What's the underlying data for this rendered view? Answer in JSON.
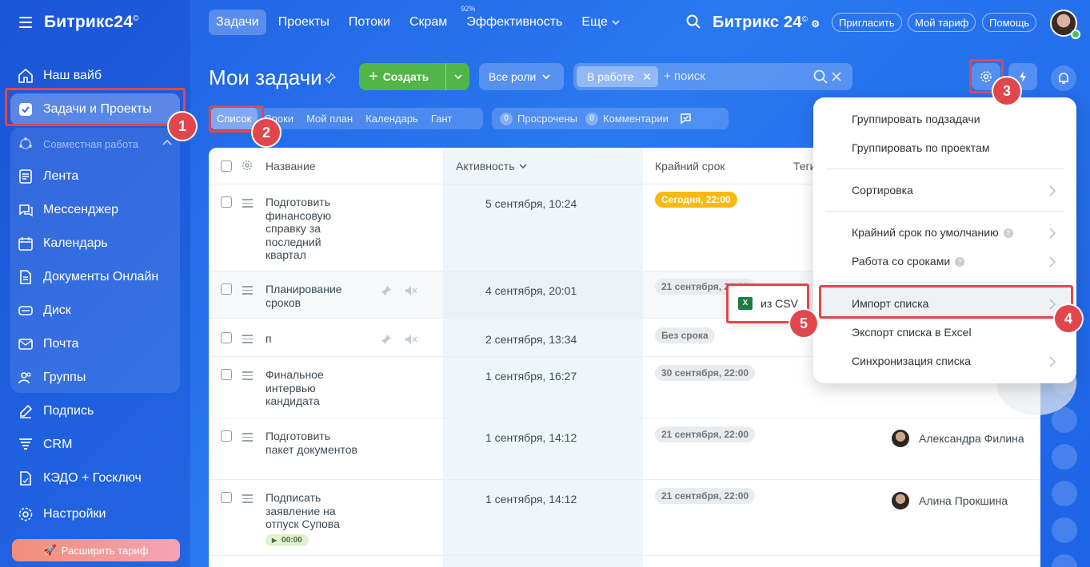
{
  "sidebar": {
    "logo": "Битрикс24",
    "logo_mark": "©",
    "items": [
      {
        "label": "Наш вайб"
      },
      {
        "label": "Задачи и Проекты"
      },
      {
        "label": "Совместная работа"
      },
      {
        "label": "Лента"
      },
      {
        "label": "Мессенджер"
      },
      {
        "label": "Календарь"
      },
      {
        "label": "Документы Онлайн"
      },
      {
        "label": "Диск"
      },
      {
        "label": "Почта"
      },
      {
        "label": "Группы"
      },
      {
        "label": "Подпись"
      },
      {
        "label": "CRM"
      },
      {
        "label": "КЭДО + Госключ"
      },
      {
        "label": "Настройки"
      }
    ],
    "upgrade_label": "Расширить тариф"
  },
  "topnav": {
    "items": [
      {
        "label": "Задачи"
      },
      {
        "label": "Проекты"
      },
      {
        "label": "Потоки"
      },
      {
        "label": "Скрам"
      },
      {
        "label": "Эффективность",
        "pct": "92%"
      },
      {
        "label": "Еще"
      }
    ],
    "brand": "Битрикс 24",
    "invite": "Пригласить",
    "tariff": "Мой тариф",
    "help": "Помощь"
  },
  "toolbar": {
    "title": "Мои задачи",
    "create_label": "Создать",
    "roles_label": "Все роли",
    "filter_chip": "В работе",
    "search_placeholder": "+ поиск"
  },
  "viewtabs": [
    "Список",
    "Сроки",
    "Мой план",
    "Календарь",
    "Гант"
  ],
  "counters": {
    "overdue_count": "0",
    "overdue_label": "Просрочены",
    "comments_count": "0",
    "comments_label": "Комментарии"
  },
  "table": {
    "headers": {
      "name": "Название",
      "activity": "Активность",
      "deadline": "Крайний срок",
      "tags": "Теги"
    },
    "rows": [
      {
        "name": "Подготовить финансовую справку за последний квартал",
        "activity": "5 сентября, 10:24",
        "deadline": "Сегодня, 22:00",
        "person": ""
      },
      {
        "name": "Планирование сроков",
        "activity": "4 сентября, 20:01",
        "deadline": "21 сентября, 22:00",
        "person": ""
      },
      {
        "name": "п",
        "activity": "2 сентября, 13:34",
        "deadline": "Без срока",
        "person": ""
      },
      {
        "name": "Финальное интервью кандидата",
        "activity": "1 сентября, 16:27",
        "deadline": "30 сентября, 22:00",
        "person": ""
      },
      {
        "name": "Подготовить пакет документов",
        "activity": "1 сентября, 14:12",
        "deadline": "21 сентября, 22:00",
        "person": "Александра Филина"
      },
      {
        "name": "Подписать заявление на отпуск Супова",
        "activity": "1 сентября, 14:12",
        "deadline": "21 сентября, 22:00",
        "person": "Алина Прокшина",
        "timer": "00:00"
      }
    ]
  },
  "menu": {
    "items": [
      {
        "label": "Группировать подзадачи"
      },
      {
        "label": "Группировать по проектам"
      },
      {
        "label": "Сортировка"
      },
      {
        "label": "Крайний срок по умолчанию"
      },
      {
        "label": "Работа со сроками"
      },
      {
        "label": "Импорт списка"
      },
      {
        "label": "Экспорт списка в Excel"
      },
      {
        "label": "Синхронизация списка"
      }
    ],
    "submenu_label": "из CSV",
    "submenu_icon": "X"
  },
  "annotations": [
    "1",
    "2",
    "3",
    "4",
    "5"
  ],
  "colors": {
    "accent": "#2066e8",
    "create": "#52b547",
    "marker": "#e0474c",
    "badge_today": "#f9b90f"
  }
}
